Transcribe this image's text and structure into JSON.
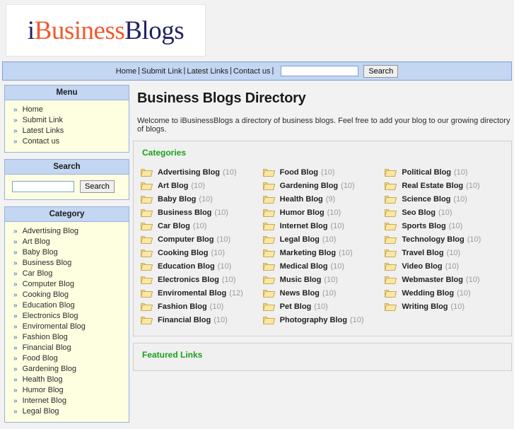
{
  "logo": {
    "part1": "i",
    "part2": "Business",
    "part3": "Blogs"
  },
  "nav": {
    "links": [
      "Home",
      "Submit Link",
      "Latest Links",
      "Contact us"
    ],
    "separator": "|",
    "search_value": "",
    "search_placeholder": "",
    "search_button": "Search"
  },
  "sidebar": {
    "menu": {
      "title": "Menu",
      "items": [
        "Home",
        "Submit Link",
        "Latest Links",
        "Contact us"
      ]
    },
    "search": {
      "title": "Search",
      "value": "",
      "placeholder": "",
      "button": "Search"
    },
    "category": {
      "title": "Category",
      "items": [
        "Advertising Blog",
        "Art Blog",
        "Baby Blog",
        "Business Blog",
        "Car Blog",
        "Computer Blog",
        "Cooking Blog",
        "Education Blog",
        "Electronics Blog",
        "Enviromental Blog",
        "Fashion Blog",
        "Financial Blog",
        "Food Blog",
        "Gardening Blog",
        "Health Blog",
        "Humor Blog",
        "Internet Blog",
        "Legal Blog"
      ]
    }
  },
  "main": {
    "title": "Business Blogs Directory",
    "intro": "Welcome to iBusinessBlogs a directory of business blogs. Feel free to add your blog to our growing directory of blogs.",
    "categories_title": "Categories",
    "featured_title": "Featured Links",
    "categories": [
      {
        "name": "Advertising Blog",
        "count": "(10)"
      },
      {
        "name": "Art Blog",
        "count": "(10)"
      },
      {
        "name": "Baby Blog",
        "count": "(10)"
      },
      {
        "name": "Business Blog",
        "count": "(10)"
      },
      {
        "name": "Car Blog",
        "count": "(10)"
      },
      {
        "name": "Computer Blog",
        "count": "(10)"
      },
      {
        "name": "Cooking Blog",
        "count": "(10)"
      },
      {
        "name": "Education Blog",
        "count": "(10)"
      },
      {
        "name": "Electronics Blog",
        "count": "(10)"
      },
      {
        "name": "Enviromental Blog",
        "count": "(12)"
      },
      {
        "name": "Fashion Blog",
        "count": "(10)"
      },
      {
        "name": "Financial Blog",
        "count": "(10)"
      },
      {
        "name": "Food Blog",
        "count": "(10)"
      },
      {
        "name": "Gardening Blog",
        "count": "(10)"
      },
      {
        "name": "Health Blog",
        "count": "(9)"
      },
      {
        "name": "Humor Blog",
        "count": "(10)"
      },
      {
        "name": "Internet Blog",
        "count": "(10)"
      },
      {
        "name": "Legal Blog",
        "count": "(10)"
      },
      {
        "name": "Marketing Blog",
        "count": "(10)"
      },
      {
        "name": "Medical Blog",
        "count": "(10)"
      },
      {
        "name": "Music Blog",
        "count": "(10)"
      },
      {
        "name": "News Blog",
        "count": "(10)"
      },
      {
        "name": "Pet Blog",
        "count": "(10)"
      },
      {
        "name": "Photography Blog",
        "count": "(10)"
      },
      {
        "name": "Political Blog",
        "count": "(10)"
      },
      {
        "name": "Real Estate Blog",
        "count": "(10)"
      },
      {
        "name": "Science Blog",
        "count": "(10)"
      },
      {
        "name": "Seo Blog",
        "count": "(10)"
      },
      {
        "name": "Sports Blog",
        "count": "(10)"
      },
      {
        "name": "Technology Blog",
        "count": "(10)"
      },
      {
        "name": "Travel Blog",
        "count": "(10)"
      },
      {
        "name": "Video Blog",
        "count": "(10)"
      },
      {
        "name": "Webmaster Blog",
        "count": "(10)"
      },
      {
        "name": "Wedding Blog",
        "count": "(10)"
      },
      {
        "name": "Writing Blog",
        "count": "(10)"
      }
    ]
  },
  "icons": {
    "bullet": "»",
    "folder": "folder-icon"
  },
  "colors": {
    "nav_bg": "#c3d6f2",
    "nav_border": "#7da0d4",
    "panel_bg": "#feffe1",
    "panel_border": "#97b2dc",
    "accent_green": "#1ba01b",
    "logo_navy": "#232261",
    "logo_orange": "#f1592a",
    "page_bg": "#f2f2f2",
    "box_bg": "#f0f0f0",
    "folder_fill": "#fbdf8a"
  }
}
